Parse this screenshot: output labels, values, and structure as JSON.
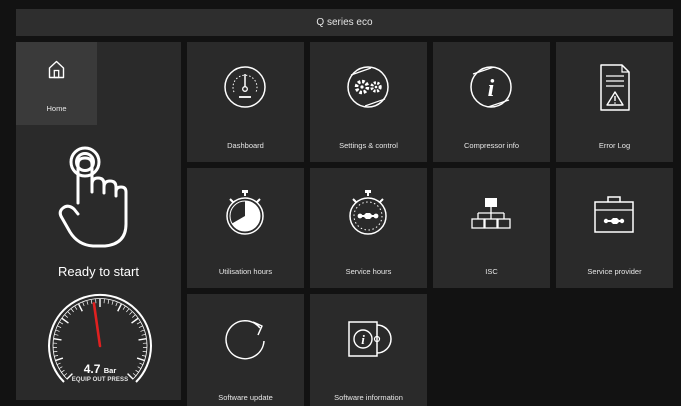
{
  "app": {
    "title": "Q series eco"
  },
  "sidebar": {
    "home_label": "Home",
    "status_text": "Ready to start",
    "gauge": {
      "value": "4.7",
      "unit": "Bar",
      "label": "EQUIP OUT PRESS",
      "needle_value": 4.7
    }
  },
  "tiles": [
    {
      "label": "Dashboard",
      "icon": "dashboard-gauge-icon"
    },
    {
      "label": "Settings & control",
      "icon": "settings-gears-icon"
    },
    {
      "label": "Compressor info",
      "icon": "info-icon"
    },
    {
      "label": "Error Log",
      "icon": "error-log-icon"
    },
    {
      "label": "Utilisation hours",
      "icon": "stopwatch-icon"
    },
    {
      "label": "Service hours",
      "icon": "service-stopwatch-icon"
    },
    {
      "label": "ISC",
      "icon": "network-hierarchy-icon"
    },
    {
      "label": "Service provider",
      "icon": "toolbox-icon"
    },
    {
      "label": "Software update",
      "icon": "refresh-icon"
    },
    {
      "label": "Software information",
      "icon": "software-info-icon"
    }
  ],
  "colors": {
    "background": "#121212",
    "panel": "#2a2a2a",
    "home_active": "#3a3a3a",
    "needle": "#e02020"
  }
}
